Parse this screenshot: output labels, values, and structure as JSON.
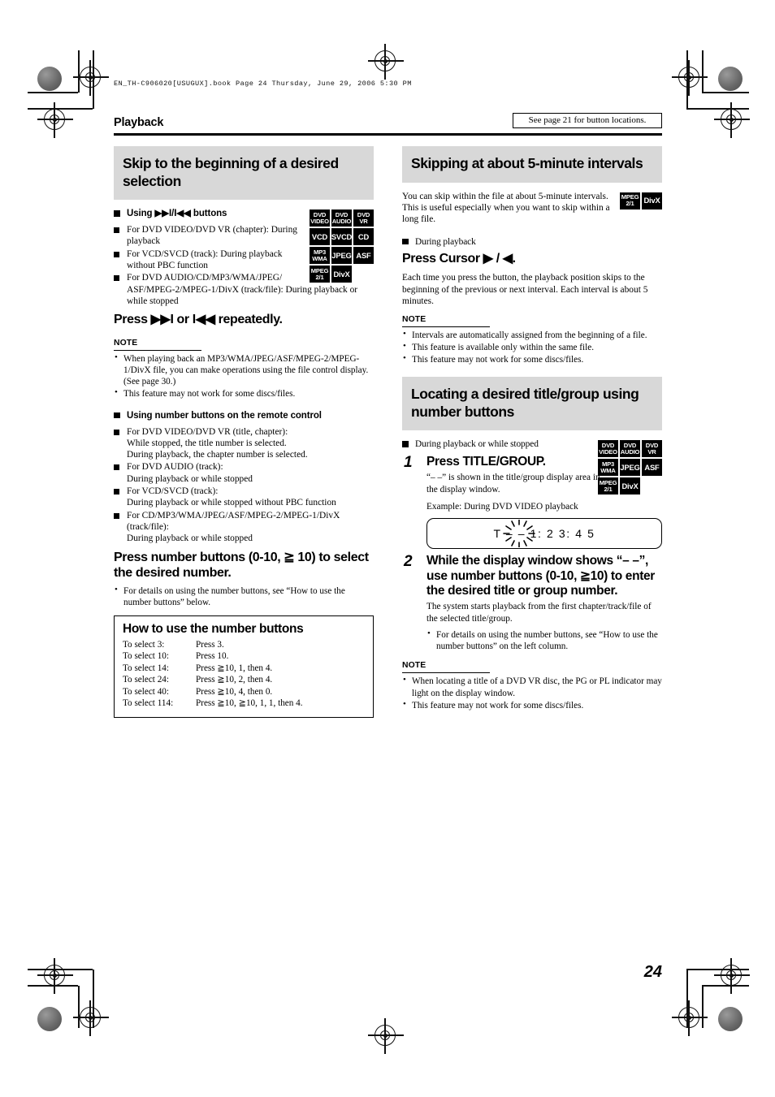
{
  "printer_header": "EN_TH-C906020[USUGUX].book  Page 24  Thursday, June 29, 2006  5:30 PM",
  "running_head": {
    "chapter": "Playback",
    "see_page_note": "See page 21 for button locations."
  },
  "page_number": "24",
  "left_column": {
    "section_title": "Skip to the beginning of a desired selection",
    "badges": [
      {
        "l1": "DVD",
        "l2": "VIDEO",
        "state": "on"
      },
      {
        "l1": "DVD",
        "l2": "AUDIO",
        "state": "on"
      },
      {
        "l1": "DVD",
        "l2": "VR",
        "state": "on"
      },
      {
        "l1": "VCD",
        "l2": "",
        "state": "on"
      },
      {
        "l1": "SVCD",
        "l2": "",
        "state": "on"
      },
      {
        "l1": "CD",
        "l2": "",
        "state": "on"
      },
      {
        "l1": "MP3",
        "l2": "WMA",
        "state": "on"
      },
      {
        "l1": "JPEG",
        "l2": "",
        "state": "on"
      },
      {
        "l1": "ASF",
        "l2": "",
        "state": "on"
      },
      {
        "l1": "MPEG",
        "l2": "2/1",
        "state": "on"
      },
      {
        "l1": "DivX",
        "l2": "",
        "state": "on"
      },
      {
        "l1": "",
        "l2": "",
        "state": "blank"
      }
    ],
    "sub_head_1": "Using ▶▶I/I◀◀ buttons",
    "conditions_1": [
      {
        "main": "For DVD VIDEO/DVD VR (chapter): During",
        "sub": "playback"
      },
      {
        "main": "For VCD/SVCD (track): During playback",
        "sub": "without PBC function"
      },
      {
        "main": "For DVD AUDIO/CD/MP3/WMA/JPEG/",
        "sub": "ASF/MPEG-2/MPEG-1/DivX (track/file): During playback or while stopped"
      }
    ],
    "command_1": "Press ▶▶I or I◀◀ repeatedly.",
    "note_label_1": "NOTE",
    "notes_1": [
      "When playing back an MP3/WMA/JPEG/ASF/MPEG-2/MPEG-1/DivX file, you can make operations using the file control display. (See page 30.)",
      "This feature may not work for some discs/files."
    ],
    "sub_head_2": "Using number buttons on the remote control",
    "conditions_2": [
      {
        "main": "For DVD VIDEO/DVD VR (title, chapter):",
        "sub": "While stopped, the title number is selected.\nDuring playback, the chapter number is selected."
      },
      {
        "main": "For DVD AUDIO (track):",
        "sub": "During playback or while stopped"
      },
      {
        "main": "For VCD/SVCD (track):",
        "sub": "During playback or while stopped without PBC function"
      },
      {
        "main": "For CD/MP3/WMA/JPEG/ASF/MPEG-2/MPEG-1/DivX",
        "sub": "(track/file):\nDuring playback or while stopped"
      }
    ],
    "command_2": "Press number buttons (0-10, ≧ 10) to select the desired number.",
    "command_2_notes": [
      "For details on using the number buttons, see “How to use the number buttons” below."
    ],
    "howto": {
      "title": "How to use the number buttons",
      "rows": [
        {
          "label": "To select 3:",
          "action": "Press 3."
        },
        {
          "label": "To select 10:",
          "action": "Press 10."
        },
        {
          "label": "To select 14:",
          "action": "Press ≧10, 1, then 4."
        },
        {
          "label": "To select 24:",
          "action": "Press ≧10, 2, then 4."
        },
        {
          "label": "To select 40:",
          "action": "Press ≧10, 4, then 0."
        },
        {
          "label": "To select 114:",
          "action": "Press ≧10, ≧10, 1, 1, then 4."
        }
      ]
    }
  },
  "right_column": {
    "section_title_1": "Skipping at about 5-minute intervals",
    "badges_1": [
      {
        "l1": "MPEG",
        "l2": "2/1",
        "state": "on"
      },
      {
        "l1": "DivX",
        "l2": "",
        "state": "on"
      }
    ],
    "intro": "You can skip within the file at about 5-minute intervals. This is useful especially when you want to skip within a long file.",
    "sub_head_1": "During playback",
    "command_1": "Press Cursor ▶ / ◀.",
    "command_1_body": "Each time you press the button, the playback position skips to the beginning of the previous or next interval. Each interval is about 5 minutes.",
    "note_label_1": "NOTE",
    "notes_1": [
      "Intervals are automatically assigned from the beginning of a file.",
      "This feature is available only within the same file.",
      "This feature may not work for some discs/files."
    ],
    "section_title_2": "Locating a desired title/group using number buttons",
    "badges_2": [
      {
        "l1": "DVD",
        "l2": "VIDEO",
        "state": "on"
      },
      {
        "l1": "DVD",
        "l2": "AUDIO",
        "state": "on"
      },
      {
        "l1": "DVD",
        "l2": "VR",
        "state": "on"
      },
      {
        "l1": "MP3",
        "l2": "WMA",
        "state": "on"
      },
      {
        "l1": "JPEG",
        "l2": "",
        "state": "on"
      },
      {
        "l1": "ASF",
        "l2": "",
        "state": "on"
      },
      {
        "l1": "MPEG",
        "l2": "2/1",
        "state": "on"
      },
      {
        "l1": "DivX",
        "l2": "",
        "state": "on"
      },
      {
        "l1": "",
        "l2": "",
        "state": "blank"
      }
    ],
    "sub_head_2": "During playback or while stopped",
    "step1": {
      "number": "1",
      "command": "Press TITLE/GROUP.",
      "body": "“– –” is shown in the title/group display area in the display window.",
      "example_label": "Example: During DVD VIDEO playback",
      "display_window_text": "T – – 1: 2  3: 4  5"
    },
    "step2": {
      "number": "2",
      "command": "While the display window shows “– –”, use number buttons (0-10, ≧10) to enter the desired title or group number.",
      "body": "The system starts playback from the first chapter/track/file of the selected title/group.",
      "bullets": [
        "For details on using the number buttons, see “How to use the number buttons” on the left column."
      ]
    },
    "note_label_2": "NOTE",
    "notes_2": [
      "When locating a title of a DVD VR disc, the PG or PL indicator may light on the display window.",
      "This feature may not work for some discs/files."
    ]
  }
}
